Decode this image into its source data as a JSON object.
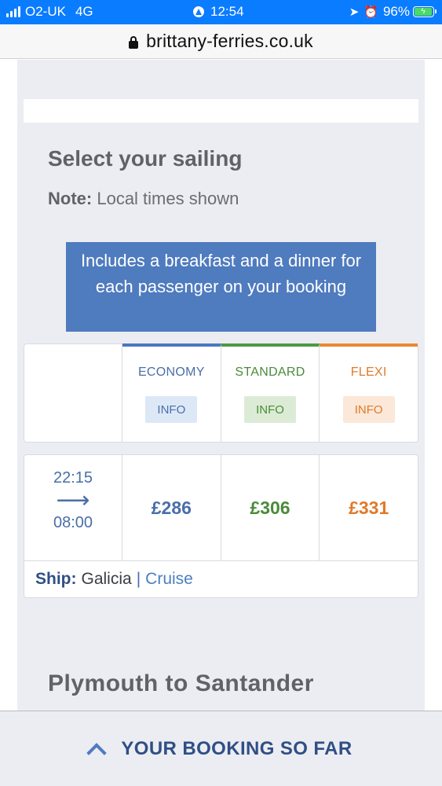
{
  "status_bar": {
    "carrier": "O2-UK",
    "network": "4G",
    "time": "12:54",
    "battery": "96%",
    "battery_level": 0.96
  },
  "url_bar": {
    "url": "brittany-ferries.co.uk"
  },
  "sailing": {
    "heading": "Select your sailing",
    "note_label": "Note:",
    "note_text": "Local times shown",
    "banner": "Includes a breakfast and a dinner for each passenger on your booking",
    "fares": [
      {
        "name": "ECONOMY",
        "info": "INFO",
        "color": "#4a6ea9",
        "bar": "#4a78c0",
        "info_bg": "#dde8f7"
      },
      {
        "name": "STANDARD",
        "info": "INFO",
        "color": "#4a8a3b",
        "bar": "#4d9a44",
        "info_bg": "#dcebd6"
      },
      {
        "name": "FLEXI",
        "info": "INFO",
        "color": "#e07a2a",
        "bar": "#e88a35",
        "info_bg": "#fbe8d8"
      }
    ],
    "row": {
      "depart": "22:15",
      "arrow": "⟶",
      "arrive": "08:00",
      "prices": [
        "£286",
        "£306",
        "£331"
      ],
      "ship_label": "Ship:",
      "ship_name": "Galicia",
      "separator": "|",
      "ship_type": "Cruise"
    }
  },
  "route": {
    "from": "Plymouth",
    "to_word": "to",
    "dest": "Santander"
  },
  "bottom_bar": {
    "label": "YOUR BOOKING SO FAR"
  }
}
